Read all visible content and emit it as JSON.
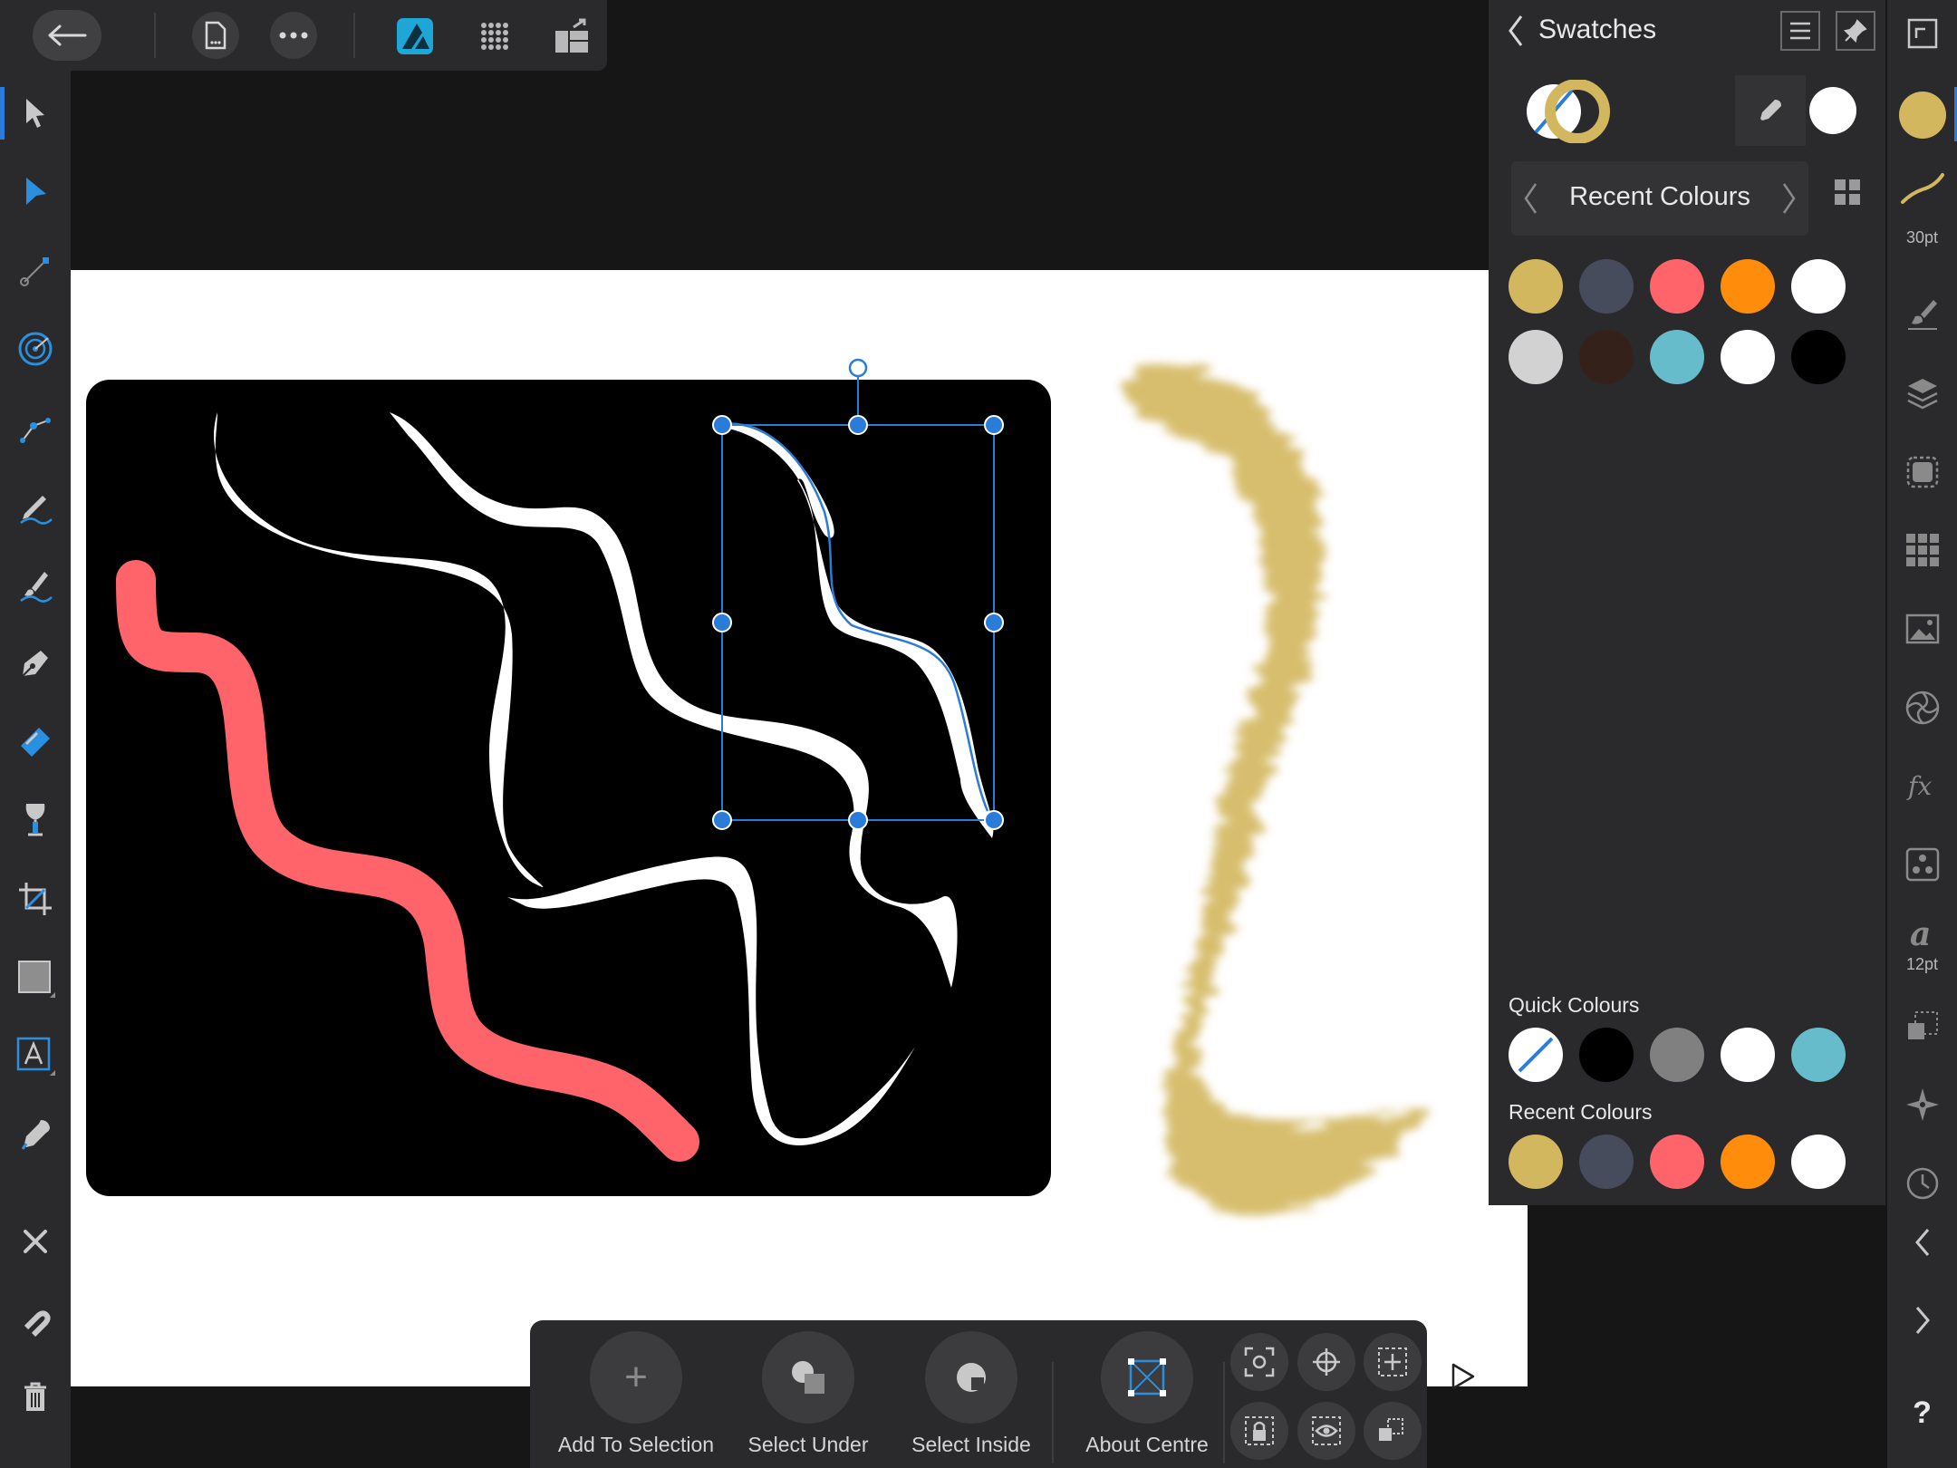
{
  "app": {
    "name": "Affinity Designer"
  },
  "panel": {
    "title": "Swatches",
    "palette_name": "Recent Colours",
    "palette_swatches": [
      "#d3b75f",
      "#474c5c",
      "#fe646a",
      "#ff8c0a",
      "#ffffff",
      "#d2d2d2",
      "#33211a",
      "#66bccb",
      "#ffffff",
      "#000000"
    ],
    "quick_label": "Quick Colours",
    "quick_swatches": [
      "none",
      "#000000",
      "#808080",
      "#ffffff",
      "#66bccb"
    ],
    "recent_label": "Recent Colours",
    "recent_swatches": [
      "#d3b75f",
      "#474c5c",
      "#fe646a",
      "#ff8c0a",
      "#ffffff"
    ],
    "fill_colour": "#ffffff",
    "stroke_colour": "#d3b75f"
  },
  "studio": {
    "stroke_width": "30pt",
    "text_size": "12pt",
    "current_colour": "#d3b75f",
    "help": "?"
  },
  "context_bar": {
    "add_to_selection": "Add To Selection",
    "select_under": "Select Under",
    "select_inside": "Select Inside",
    "about_centre": "About Centre",
    "add_symbol": "+"
  },
  "colors": {
    "accent": "#2b7bd8",
    "pink_stroke": "#fe646a",
    "gold_brush": "#d3b75f"
  }
}
